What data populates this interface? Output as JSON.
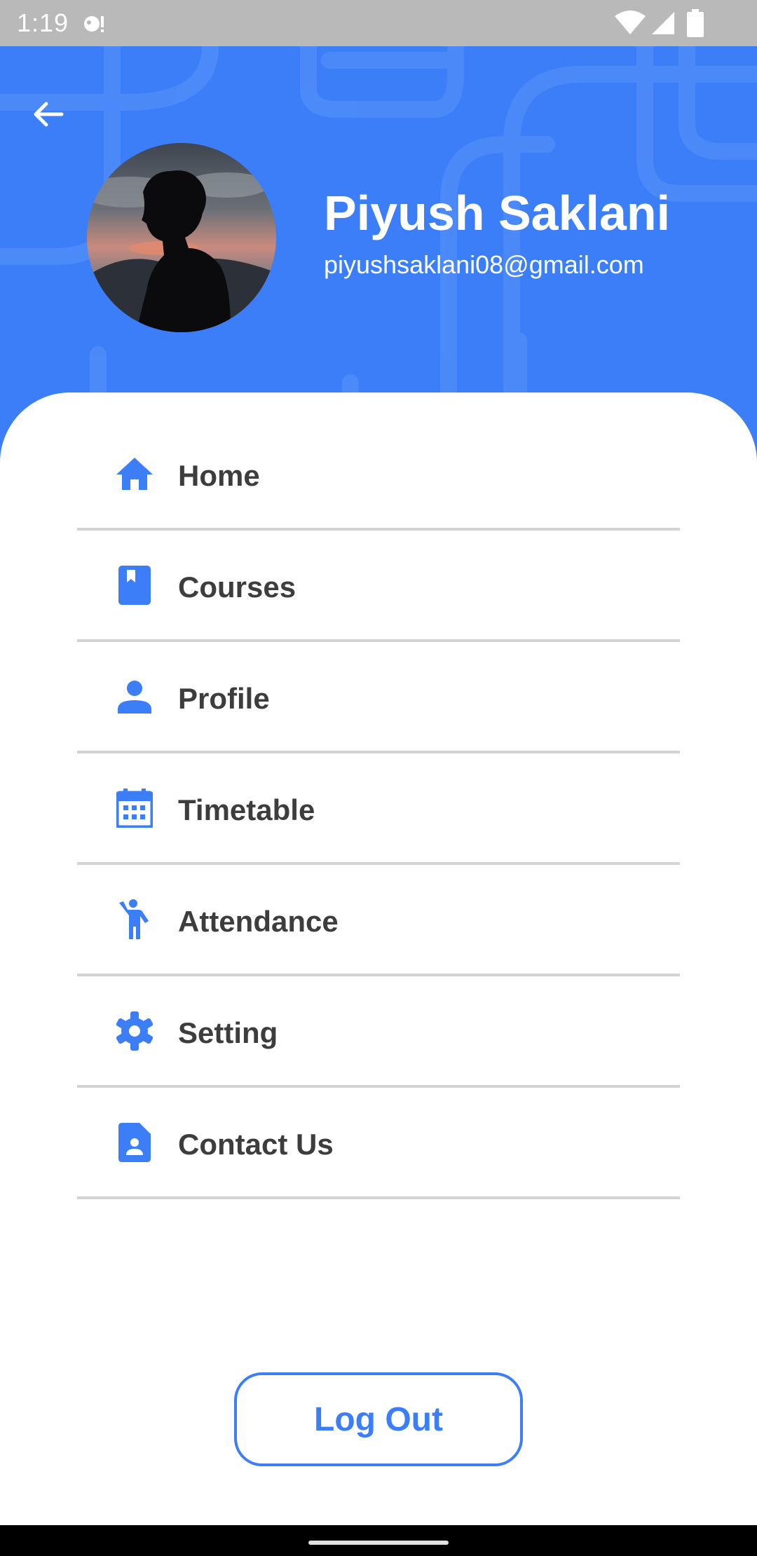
{
  "status_bar": {
    "time": "1:19",
    "icons": [
      "notification-icon",
      "wifi-icon",
      "signal-icon",
      "battery-icon"
    ]
  },
  "header": {
    "background_color": "#3b7ef8",
    "back_icon": "arrow-back-icon",
    "user": {
      "name": "Piyush Saklani",
      "email": "piyushsaklani08@gmail.com"
    }
  },
  "menu": {
    "items": [
      {
        "label": "Home",
        "icon": "home-icon"
      },
      {
        "label": "Courses",
        "icon": "book-icon"
      },
      {
        "label": "Profile",
        "icon": "person-icon"
      },
      {
        "label": "Timetable",
        "icon": "calendar-icon"
      },
      {
        "label": "Attendance",
        "icon": "attendance-icon"
      },
      {
        "label": "Setting",
        "icon": "gear-icon"
      },
      {
        "label": "Contact Us",
        "icon": "contact-icon"
      }
    ]
  },
  "logout": {
    "label": "Log Out"
  },
  "colors": {
    "accent": "#3b7ef8",
    "text": "#3d3d3d",
    "divider": "#d3d3d3"
  }
}
